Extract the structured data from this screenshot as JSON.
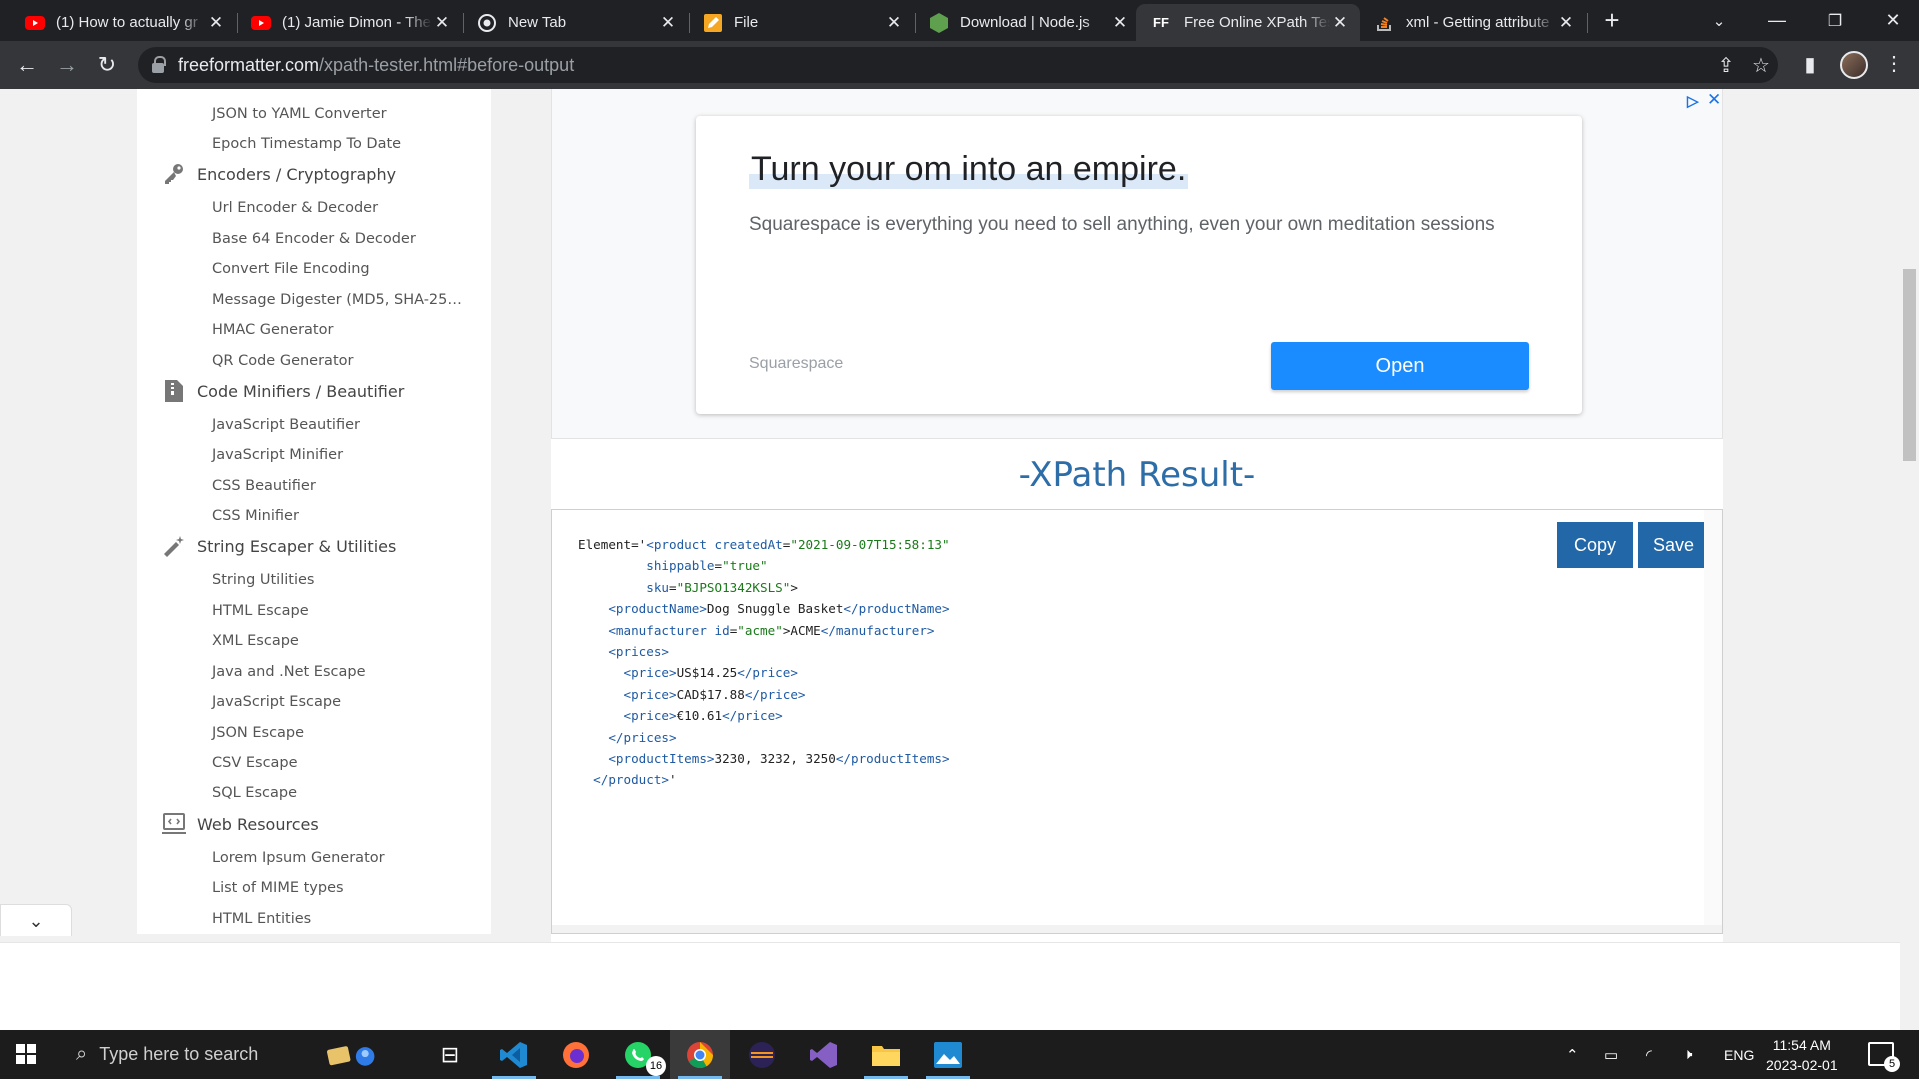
{
  "browser": {
    "tabs": [
      {
        "title": "(1) How to actually gr",
        "favicon": "youtube-icon"
      },
      {
        "title": "(1) Jamie Dimon - The",
        "favicon": "youtube-icon"
      },
      {
        "title": "New Tab",
        "favicon": "chrome-icon"
      },
      {
        "title": "File",
        "favicon": "file-pencil-icon"
      },
      {
        "title": "Download | Node.js",
        "favicon": "nodejs-icon"
      },
      {
        "title": "Free Online XPath Tes",
        "favicon": "ff-icon",
        "favicon_text": "FF"
      },
      {
        "title": "xml - Getting attribute",
        "favicon": "stackoverflow-icon"
      }
    ],
    "active_tab": 5,
    "url_domain": "freeformatter.com",
    "url_rest": "/xpath-tester.html#before-output"
  },
  "sidebar": {
    "top_items": [
      "JSON to YAML Converter",
      "Epoch Timestamp To Date"
    ],
    "categories": [
      {
        "label": "Encoders / Cryptography",
        "icon": "key-icon",
        "items": [
          "Url Encoder & Decoder",
          "Base 64 Encoder & Decoder",
          "Convert File Encoding",
          "Message Digester (MD5, SHA-25…",
          "HMAC Generator",
          "QR Code Generator"
        ]
      },
      {
        "label": "Code Minifiers / Beautifier",
        "icon": "file-zip-icon",
        "items": [
          "JavaScript Beautifier",
          "JavaScript Minifier",
          "CSS Beautifier",
          "CSS Minifier"
        ]
      },
      {
        "label": "String Escaper & Utilities",
        "icon": "magic-wand-icon",
        "items": [
          "String Utilities",
          "HTML Escape",
          "XML Escape",
          "Java and .Net Escape",
          "JavaScript Escape",
          "JSON Escape",
          "CSV Escape",
          "SQL Escape"
        ]
      },
      {
        "label": "Web Resources",
        "icon": "laptop-code-icon",
        "items": [
          "Lorem Ipsum Generator",
          "List of MIME types",
          "HTML Entities"
        ]
      }
    ]
  },
  "ad": {
    "headline": "Turn your om into an empire.",
    "body": "Squarespace is everything you need to sell anything, even your own meditation sessions",
    "source": "Squarespace",
    "cta": "Open"
  },
  "result": {
    "title": "-XPath Result-",
    "copy_label": "Copy",
    "save_label": "Save",
    "product": {
      "createdAt": "2021-09-07T15:58:13",
      "shippable": "true",
      "sku": "BJPSO1342KSLS",
      "productName": "Dog Snuggle Basket",
      "manufacturer_id": "acme",
      "manufacturer": "ACME",
      "prices": [
        "US$14.25",
        "CAD$17.88",
        "€10.61"
      ],
      "productItems": "3230, 3232, 3250"
    }
  },
  "taskbar": {
    "search_placeholder": "Type here to search",
    "whatsapp_badge": "16",
    "language": "ENG",
    "time": "11:54 AM",
    "date": "2023-02-01",
    "notifications": "5"
  }
}
